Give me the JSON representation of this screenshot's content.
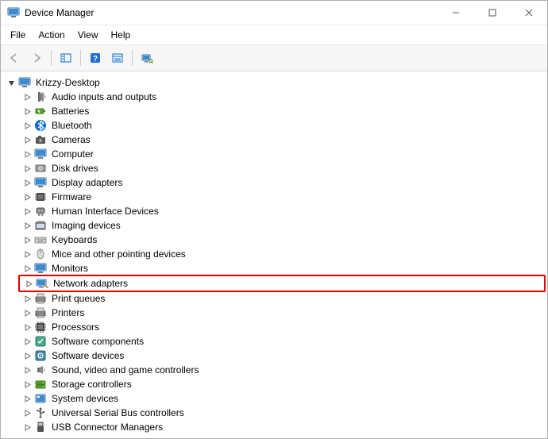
{
  "window": {
    "title": "Device Manager"
  },
  "menus": {
    "file": "File",
    "action": "Action",
    "view": "View",
    "help": "Help"
  },
  "tree": {
    "root": "Krizzy-Desktop",
    "categories": [
      {
        "label": "Audio inputs and outputs",
        "icon": "speaker",
        "hl": false
      },
      {
        "label": "Batteries",
        "icon": "battery",
        "hl": false
      },
      {
        "label": "Bluetooth",
        "icon": "bluetooth",
        "hl": false
      },
      {
        "label": "Cameras",
        "icon": "camera",
        "hl": false
      },
      {
        "label": "Computer",
        "icon": "computer",
        "hl": false
      },
      {
        "label": "Disk drives",
        "icon": "disk",
        "hl": false
      },
      {
        "label": "Display adapters",
        "icon": "display",
        "hl": false
      },
      {
        "label": "Firmware",
        "icon": "firmware",
        "hl": false
      },
      {
        "label": "Human Interface Devices",
        "icon": "hid",
        "hl": false
      },
      {
        "label": "Imaging devices",
        "icon": "imaging",
        "hl": false
      },
      {
        "label": "Keyboards",
        "icon": "keyboard",
        "hl": false
      },
      {
        "label": "Mice and other pointing devices",
        "icon": "mouse",
        "hl": false
      },
      {
        "label": "Monitors",
        "icon": "monitor",
        "hl": false
      },
      {
        "label": "Network adapters",
        "icon": "network",
        "hl": true
      },
      {
        "label": "Print queues",
        "icon": "printqueue",
        "hl": false
      },
      {
        "label": "Printers",
        "icon": "printer",
        "hl": false
      },
      {
        "label": "Processors",
        "icon": "processor",
        "hl": false
      },
      {
        "label": "Software components",
        "icon": "swcomp",
        "hl": false
      },
      {
        "label": "Software devices",
        "icon": "swdev",
        "hl": false
      },
      {
        "label": "Sound, video and game controllers",
        "icon": "sound",
        "hl": false
      },
      {
        "label": "Storage controllers",
        "icon": "storage",
        "hl": false
      },
      {
        "label": "System devices",
        "icon": "system",
        "hl": false
      },
      {
        "label": "Universal Serial Bus controllers",
        "icon": "usb",
        "hl": false
      },
      {
        "label": "USB Connector Managers",
        "icon": "usbconn",
        "hl": false
      }
    ]
  }
}
